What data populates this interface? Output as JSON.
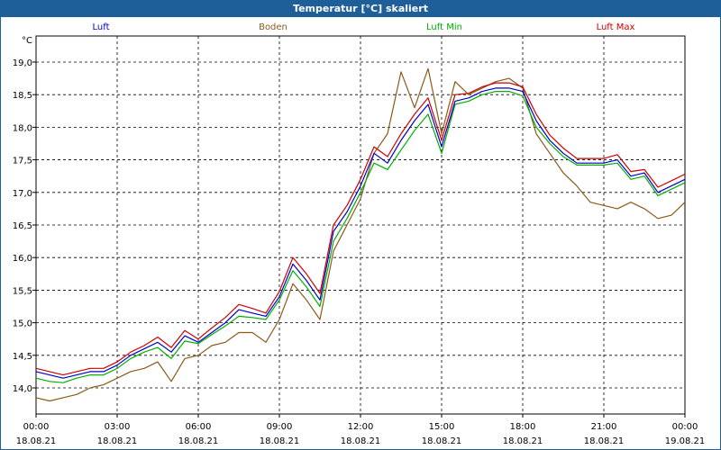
{
  "window": {
    "title": "Temperatur [°C] skaliert"
  },
  "chart_data": {
    "type": "line",
    "title": "Temperatur [°C] skaliert",
    "ylabel": "°C",
    "ylim": [
      13.6,
      19.4
    ],
    "yticks": [
      "14,0",
      "14,5",
      "15,0",
      "15,5",
      "16,0",
      "16,5",
      "17,0",
      "17,5",
      "18,0",
      "18,5",
      "19,0"
    ],
    "ytick_values": [
      14.0,
      14.5,
      15.0,
      15.5,
      16.0,
      16.5,
      17.0,
      17.5,
      18.0,
      18.5,
      19.0
    ],
    "x_range": [
      0,
      24
    ],
    "xticks": [
      {
        "time": "00:00",
        "date": "18.08.21"
      },
      {
        "time": "03:00",
        "date": "18.08.21"
      },
      {
        "time": "06:00",
        "date": "18.08.21"
      },
      {
        "time": "09:00",
        "date": "18.08.21"
      },
      {
        "time": "12:00",
        "date": "18.08.21"
      },
      {
        "time": "15:00",
        "date": "18.08.21"
      },
      {
        "time": "18:00",
        "date": "18.08.21"
      },
      {
        "time": "21:00",
        "date": "18.08.21"
      },
      {
        "time": "00:00",
        "date": "19.08.21"
      }
    ],
    "grid": true,
    "legend": "top",
    "x_hours": [
      0,
      0.5,
      1,
      1.5,
      2,
      2.5,
      3,
      3.5,
      4,
      4.5,
      5,
      5.5,
      6,
      6.5,
      7,
      7.5,
      8,
      8.5,
      9,
      9.5,
      10,
      10.5,
      11,
      11.5,
      12,
      12.5,
      13,
      13.5,
      14,
      14.5,
      15,
      15.5,
      16,
      16.5,
      17,
      17.5,
      18,
      18.5,
      19,
      19.5,
      20,
      20.5,
      21,
      21.5,
      22,
      22.5,
      23,
      23.5,
      24
    ],
    "series": [
      {
        "name": "Luft",
        "color": "#0000cc",
        "values": [
          14.25,
          14.2,
          14.15,
          14.2,
          14.25,
          14.25,
          14.35,
          14.5,
          14.6,
          14.7,
          14.55,
          14.8,
          14.7,
          14.85,
          15.0,
          15.2,
          15.15,
          15.1,
          15.4,
          15.9,
          15.65,
          15.35,
          16.4,
          16.7,
          17.1,
          17.6,
          17.45,
          17.8,
          18.1,
          18.35,
          17.7,
          18.4,
          18.45,
          18.55,
          18.6,
          18.6,
          18.55,
          18.1,
          17.8,
          17.6,
          17.45,
          17.45,
          17.45,
          17.5,
          17.25,
          17.3,
          17.0,
          17.1,
          17.2
        ]
      },
      {
        "name": "Boden",
        "color": "#8b5a1a",
        "values": [
          13.85,
          13.8,
          13.85,
          13.9,
          14.0,
          14.05,
          14.15,
          14.25,
          14.3,
          14.4,
          14.1,
          14.45,
          14.5,
          14.65,
          14.7,
          14.85,
          14.85,
          14.7,
          15.05,
          15.6,
          15.35,
          15.05,
          16.1,
          16.5,
          16.9,
          17.6,
          17.9,
          18.85,
          18.3,
          18.9,
          17.9,
          18.7,
          18.5,
          18.6,
          18.7,
          18.75,
          18.6,
          17.9,
          17.6,
          17.3,
          17.1,
          16.85,
          16.8,
          16.75,
          16.85,
          16.75,
          16.6,
          16.65,
          16.85
        ]
      },
      {
        "name": "Luft Min",
        "color": "#00b000",
        "values": [
          14.15,
          14.1,
          14.08,
          14.15,
          14.2,
          14.2,
          14.3,
          14.45,
          14.55,
          14.62,
          14.45,
          14.72,
          14.68,
          14.82,
          14.95,
          15.1,
          15.08,
          15.05,
          15.35,
          15.8,
          15.55,
          15.25,
          16.25,
          16.6,
          17.0,
          17.45,
          17.35,
          17.65,
          17.95,
          18.2,
          17.6,
          18.35,
          18.4,
          18.5,
          18.55,
          18.55,
          18.48,
          18.0,
          17.75,
          17.55,
          17.42,
          17.42,
          17.42,
          17.45,
          17.2,
          17.25,
          16.95,
          17.05,
          17.15
        ]
      },
      {
        "name": "Luft Max",
        "color": "#cc0000",
        "values": [
          14.3,
          14.25,
          14.2,
          14.25,
          14.3,
          14.3,
          14.4,
          14.55,
          14.65,
          14.78,
          14.62,
          14.88,
          14.75,
          14.92,
          15.08,
          15.28,
          15.22,
          15.15,
          15.48,
          16.0,
          15.75,
          15.45,
          16.5,
          16.8,
          17.2,
          17.7,
          17.55,
          17.9,
          18.2,
          18.45,
          17.8,
          18.5,
          18.52,
          18.62,
          18.68,
          18.68,
          18.62,
          18.2,
          17.88,
          17.68,
          17.52,
          17.52,
          17.52,
          17.58,
          17.32,
          17.35,
          17.08,
          17.18,
          17.28
        ]
      }
    ]
  }
}
